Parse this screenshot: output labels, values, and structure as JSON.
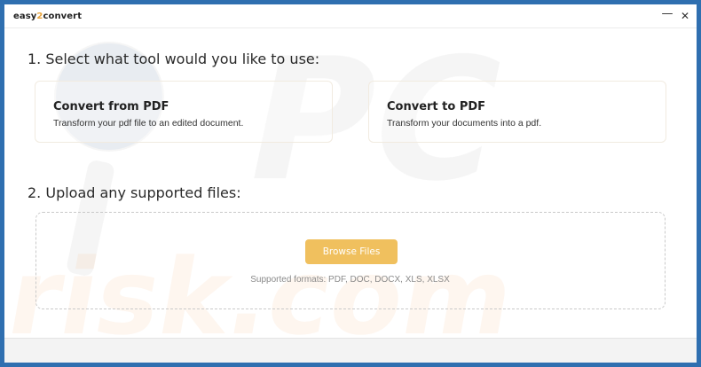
{
  "titlebar": {
    "app_name_prefix": "easy",
    "app_name_accent": "2",
    "app_name_suffix": "convert",
    "minimize_glyph": "—",
    "close_glyph": "✕"
  },
  "step1": {
    "heading": "1. Select what tool would you like to use:",
    "cards": [
      {
        "title": "Convert from PDF",
        "description": "Transform your pdf file to an edited document."
      },
      {
        "title": "Convert to PDF",
        "description": "Transform your documents into a pdf."
      }
    ]
  },
  "step2": {
    "heading": "2. Upload any supported files:",
    "browse_label": "Browse Files",
    "formats_text": "Supported formats: PDF, DOC, DOCX, XLS, XLSX"
  },
  "colors": {
    "accent": "#f0c05e",
    "window_border": "#2f6fb0"
  }
}
